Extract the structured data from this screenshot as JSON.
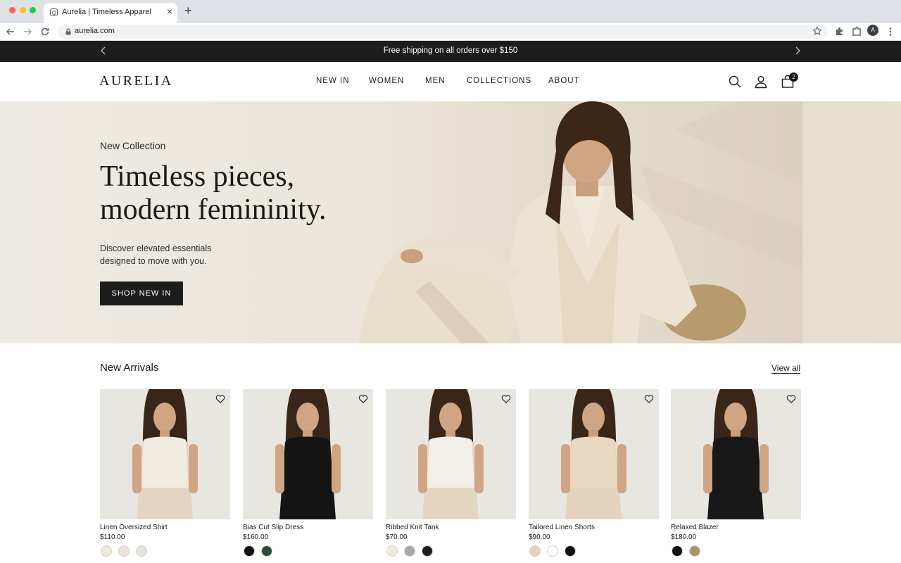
{
  "browser": {
    "tab_title": "Aurelia | Timeless Apparel",
    "url": "aurelia.com",
    "profile_initial": "A"
  },
  "announcement": {
    "text": "Free shipping on all orders over $150"
  },
  "header": {
    "logo": "AURELIA",
    "nav": [
      "NEW IN",
      "WOMEN",
      "MEN",
      "COLLECTIONS",
      "ABOUT"
    ],
    "cart_count": "2"
  },
  "hero": {
    "eyebrow": "New Collection",
    "title_line1": "Timeless pieces,",
    "title_line2": "modern femininity.",
    "subtitle_line1": "Discover elevated essentials",
    "subtitle_line2": "designed to move with you.",
    "cta": "SHOP NEW IN"
  },
  "new_arrivals": {
    "title": "New Arrivals",
    "view_all": "View all",
    "products": [
      {
        "name": "Linen Oversized Shirt",
        "price": "$110.00",
        "swatches": [
          "#efe9df",
          "#ece3d6",
          "#e4e2db"
        ],
        "garment": "#f1ebe0",
        "bottom": "#e2d5c3"
      },
      {
        "name": "Bias Cut Slip Dress",
        "price": "$160.00",
        "swatches": [
          "#111111",
          "#2e4a3a"
        ],
        "garment": "#141414",
        "bottom": "#141414"
      },
      {
        "name": "Ribbed Knit Tank",
        "price": "$70.00",
        "swatches": [
          "#efe9df",
          "#a8a8a6",
          "#1c1c1c"
        ],
        "garment": "#f2efe9",
        "bottom": "#e4d7c2"
      },
      {
        "name": "Tailored Linen Shorts",
        "price": "$90.00",
        "swatches": [
          "#e6d2bb",
          "#ffffff",
          "#111111"
        ],
        "garment": "#e9d8c2",
        "bottom": "#e4d3bd"
      },
      {
        "name": "Relaxed Blazer",
        "price": "$180.00",
        "swatches": [
          "#111111",
          "#b08f6a"
        ],
        "garment": "#181818",
        "bottom": "#181818"
      }
    ]
  },
  "colors": {
    "announcement_bg": "#1d1d1d",
    "button_bg": "#1d1d1d",
    "hero_bg": "#ece6dc",
    "card_bg": "#e9e7e2"
  },
  "icons": [
    "back-icon",
    "forward-icon",
    "reload-icon",
    "lock-icon",
    "star-icon",
    "extension-icon",
    "search-icon",
    "user-icon",
    "bag-icon",
    "heart-icon"
  ]
}
